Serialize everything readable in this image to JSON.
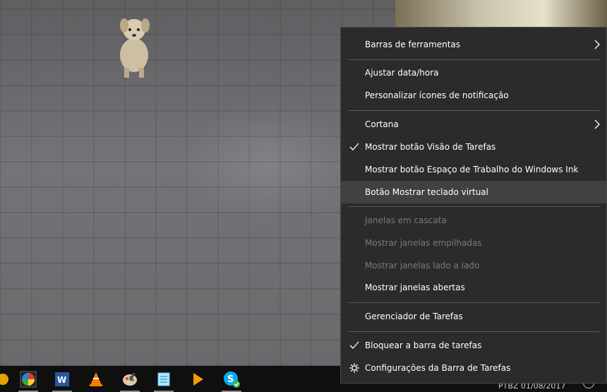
{
  "context_menu": {
    "items": [
      {
        "label": "Barras de ferramentas"
      },
      {
        "label": "Ajustar data/hora"
      },
      {
        "label": "Personalizar ícones de notificação"
      },
      {
        "label": "Cortana"
      },
      {
        "label": "Mostrar botão Visão de Tarefas"
      },
      {
        "label": "Mostrar botão Espaço de Trabalho do Windows Ink"
      },
      {
        "label": "Botão Mostrar teclado virtual"
      },
      {
        "label": "Janelas em cascata"
      },
      {
        "label": "Mostrar janelas empilhadas"
      },
      {
        "label": "Mostrar janelas lado a lado"
      },
      {
        "label": "Mostrar janelas abertas"
      },
      {
        "label": "Gerenciador de Tarefas"
      },
      {
        "label": "Bloquear a barra de tarefas"
      },
      {
        "label": "Configurações da Barra de Tarefas"
      }
    ]
  },
  "taskbar": {
    "tray_text": "PTBZ   01/08/2017",
    "icons": [
      "color-wheel-icon",
      "word-icon",
      "vlc-icon",
      "paint-icon",
      "notepad-icon",
      "media-player-icon",
      "skype-icon"
    ]
  },
  "colors": {
    "menu_bg": "#2b2b2b",
    "menu_hover": "#414141",
    "menu_text": "#ffffff",
    "menu_disabled": "#7a7a7a",
    "taskbar_bg": "#0f0f10"
  }
}
